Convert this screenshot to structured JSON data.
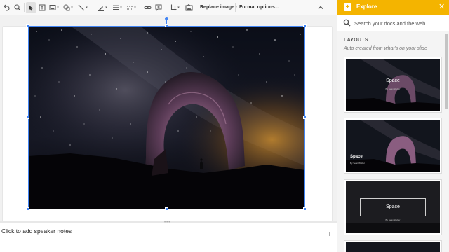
{
  "toolbar": {
    "replace_image_label": "Replace image",
    "format_options_label": "Format options...",
    "collapse_icon": "chevron-up-icon"
  },
  "slide": {
    "image_description_icon": "photo"
  },
  "notes": {
    "placeholder": "Click to add speaker notes"
  },
  "explore": {
    "title": "Explore",
    "search_placeholder": "Search your docs and the web",
    "layouts_heading": "LAYOUTS",
    "layouts_subheading": "Auto created from what's on your slide",
    "layouts": [
      {
        "title": "Space",
        "subtitle": "By Sean Weber"
      },
      {
        "title": "Space",
        "subtitle": "By Sean Weber"
      },
      {
        "title": "Space",
        "subtitle": "By Sean Weber"
      }
    ]
  },
  "colors": {
    "accent": "#4285f4",
    "explore_header": "#f4b400"
  }
}
